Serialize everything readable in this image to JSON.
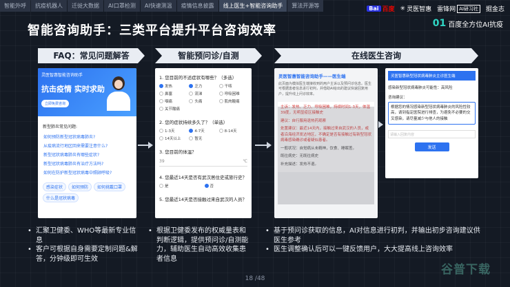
{
  "tabs": [
    "智能外呼",
    "抗疫机器人",
    "迁徙大数据",
    "AI口罩检测",
    "AI快速测温",
    "疫情信息披露",
    "线上医生+智能咨询助手",
    "算法开源等"
  ],
  "active_tab_index": 6,
  "logos": {
    "baidu_mark": "Bai",
    "baidu_text": "百度",
    "lingyi": "灵医智惠",
    "leifeng": "雷锋网",
    "ai_badge": "AI研习社",
    "yuchuang": "掘金志",
    "baidu_ai_num": "01",
    "baidu_ai_text": "百度全方位AI抗疫"
  },
  "title": "智能咨询助手：三类平台提升平台咨询效率",
  "sections": {
    "faq": "FAQ：常见问题解答",
    "pre": "智能预问诊/自测",
    "online": "在线医生咨询"
  },
  "phone1": {
    "app_title": "灵医智惠智能咨询助手",
    "hero_text": "抗击疫情 实时求助",
    "hero_button": "立即免费咨询",
    "faq_title": "新型肺炎常见问题:",
    "faq_items": [
      "如何预防新型冠状病毒肺炎?",
      "从疫病流行地区回来需要注意什么?",
      "新型冠状病毒肺炎有哪些症状?",
      "新型冠状病毒肺炎有治疗方法吗?",
      "如何在防护新型冠状病毒中照顾呼吸?"
    ],
    "chips": [
      "感染症状",
      "如何预防",
      "如何挑戴口罩",
      "什么是冠状病毒"
    ]
  },
  "phone2": {
    "q1": "1. 您目前的不适症状有哪些？（多选）",
    "q1_opts": [
      {
        "label": "发热",
        "on": true
      },
      {
        "label": "乏力",
        "on": true
      },
      {
        "label": "干咳",
        "on": false
      },
      {
        "label": "鼻塞",
        "on": false
      },
      {
        "label": "流涕",
        "on": false
      },
      {
        "label": "呼吸困难",
        "on": false
      },
      {
        "label": "咽痛",
        "on": false
      },
      {
        "label": "头痛",
        "on": false
      },
      {
        "label": "肌肉酸痛",
        "on": false
      },
      {
        "label": "关节酸痛",
        "on": false
      }
    ],
    "q2": "2. 您的症状持续多久了？（单选）",
    "q2_opts": [
      {
        "label": "1-3天",
        "on": false
      },
      {
        "label": "4-7天",
        "on": true
      },
      {
        "label": "8-14天",
        "on": false
      },
      {
        "label": "14天以上",
        "on": false
      },
      {
        "label": "暂无",
        "on": false
      }
    ],
    "q3": "3. 您目前的体温？",
    "q3_value": "39",
    "q3_unit": "℃",
    "q4": "4. 您最近14天是否有武汉居住史或旅行史？",
    "q4_opts": [
      {
        "label": "是",
        "on": false
      },
      {
        "label": "否",
        "on": true
      }
    ],
    "q5": "5. 您最近14天是否接触过来自武汉的人员？"
  },
  "phone3": {
    "head": "灵医智惠智能咨询助手——医生端",
    "para": "此页面为模拟医生端接收到的用户主诉以及预问诊信息。医生可根据患者信息进行初判，并借助AI给出的建议快速回复用户，提升线上问诊效率。",
    "lines": [
      {
        "text": "主诉：发热、乏力、呼吸困难，持续时间1-3天，体温39度，无明显疫区接触史",
        "red": true
      },
      {
        "text": "建议：自行服用退热药观察",
        "red": true
      },
      {
        "text": "处置建议：最近14天内，接触过来自武汉的人员，或者沿海经济发达地区，不确定是否有接触过有新型冠状病毒感染确诊或者疑似患者。",
        "red": true
      },
      {
        "text": "一般状况：自觉病从未精神，饮食、睡眠差。",
        "red": false
      },
      {
        "text": "既往病史：无既往病史",
        "red": false
      },
      {
        "text": "补充描述：发热不退。",
        "red": false
      }
    ]
  },
  "phone4": {
    "bar": "灵医智惠新型冠状病毒肺炎主诊医生端",
    "line1": "感染新型冠状病毒肺炎可能性：高风险",
    "line2": "咨询建议：",
    "reply": "根据您的情况感染新型冠状病毒肺炎的风险性较高，请到指定医院进行排查，为避免不必要的交叉感染，请尽量减少与他人的接触",
    "input_placeholder": "请输入回复内容",
    "send": "发送"
  },
  "bullets": {
    "col1": [
      "汇聚卫健委、WHO等最新专业信息",
      "客户可根据自身需要定制问题&解答，分钟级即可生效"
    ],
    "col2": [
      "根据卫健委发布的权威量表和判断逻辑，提供预问诊/自测能力，辅助医生自动高效收集患者信息"
    ],
    "col3": [
      "基于预问诊获取的信息，AI对信息进行初判，并输出初步咨询建议供医生参考",
      "医生调整确认后可以一键反馈用户，大大提高线上咨询效率"
    ]
  },
  "page": "18 /48",
  "watermark": "谷普下载"
}
